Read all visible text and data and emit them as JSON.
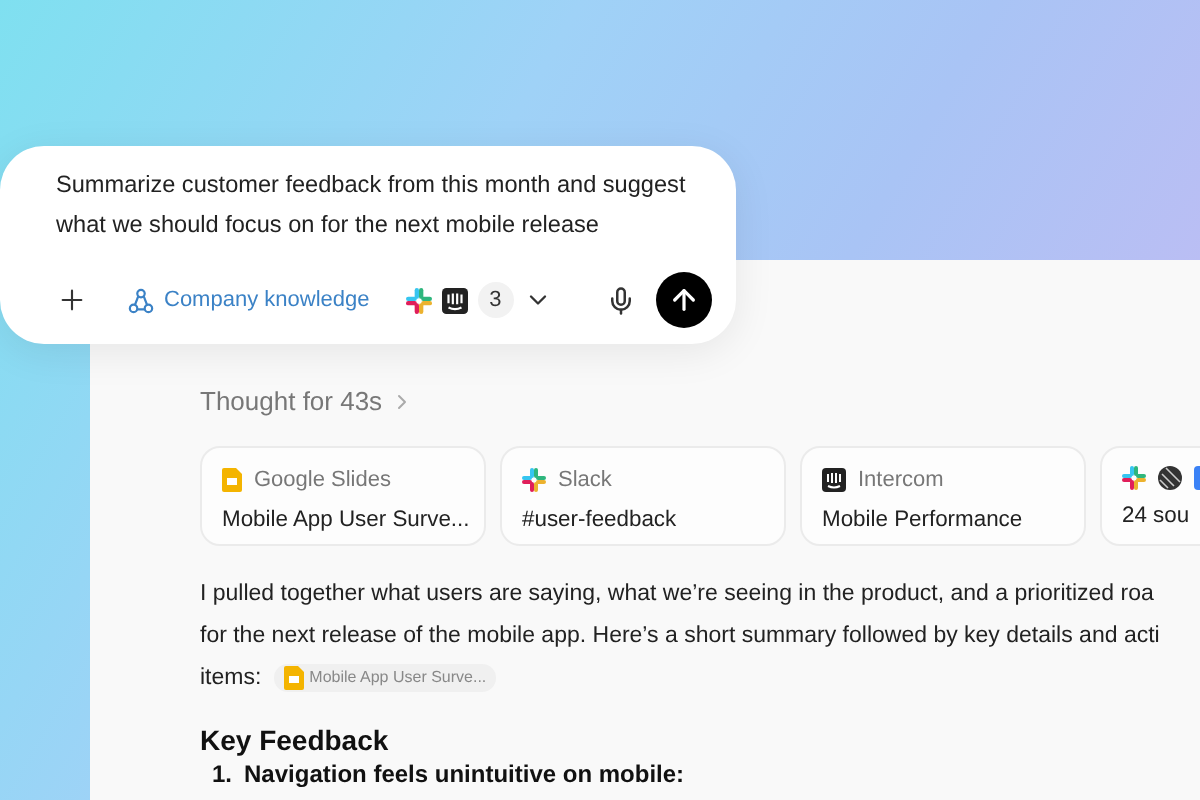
{
  "prompt": {
    "value": "Summarize customer feedback from this month and suggest what we should focus on for the next mobile release",
    "knowledge_label": "Company knowledge",
    "source_count": "3"
  },
  "thought": "Thought for 43s",
  "sources": [
    {
      "kind": "slides",
      "app": "Google Slides",
      "title": "Mobile App User Surve..."
    },
    {
      "kind": "slack",
      "app": "Slack",
      "title": "#user-feedback"
    },
    {
      "kind": "intercom",
      "app": "Intercom",
      "title": "Mobile Performance"
    },
    {
      "kind": "more",
      "title": "24 sou"
    }
  ],
  "response": {
    "lines": [
      "I pulled together what users are saying, what we’re seeing in the product, and a prioritized roa",
      "for the next release of the mobile app. Here’s a short summary followed by key details and acti",
      "items:"
    ],
    "chip": "Mobile App User Surve..."
  },
  "section": {
    "heading": "Key Feedback",
    "items": [
      {
        "number": "1.",
        "text": "Navigation feels unintuitive on mobile:"
      }
    ]
  }
}
